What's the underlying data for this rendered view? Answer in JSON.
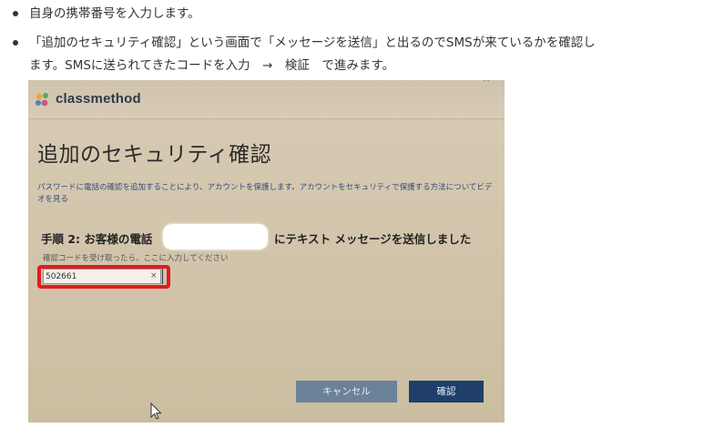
{
  "bullets": [
    {
      "lines": [
        "自身の携帯番号を入力します。"
      ]
    },
    {
      "lines": [
        "「追加のセキュリティ確認」という画面で「メッセージを送信」と出るのでSMSが来ているかを確認し",
        "ます。SMSに送られてきたコードを入力　→　検証　で進みます。"
      ]
    }
  ],
  "screenshot": {
    "logo_text": "classmethod",
    "title": "追加のセキュリティ確認",
    "description": "パスワードに電話の確認を追加することにより、アカウントを保護します。アカウントをセキュリティで保護する方法についてビデオを見る",
    "step_label": "手順 2: お客様の電話",
    "step_suffix": "にテキスト メッセージを送信しました",
    "code_hint": "確認コードを受け取ったら、ここに入力してください",
    "code_value": "502661",
    "clear_symbol": "×",
    "close_symbol": "⌃",
    "cancel_label": "キャンセル",
    "confirm_label": "確認",
    "highlight_color": "#e01b22"
  }
}
